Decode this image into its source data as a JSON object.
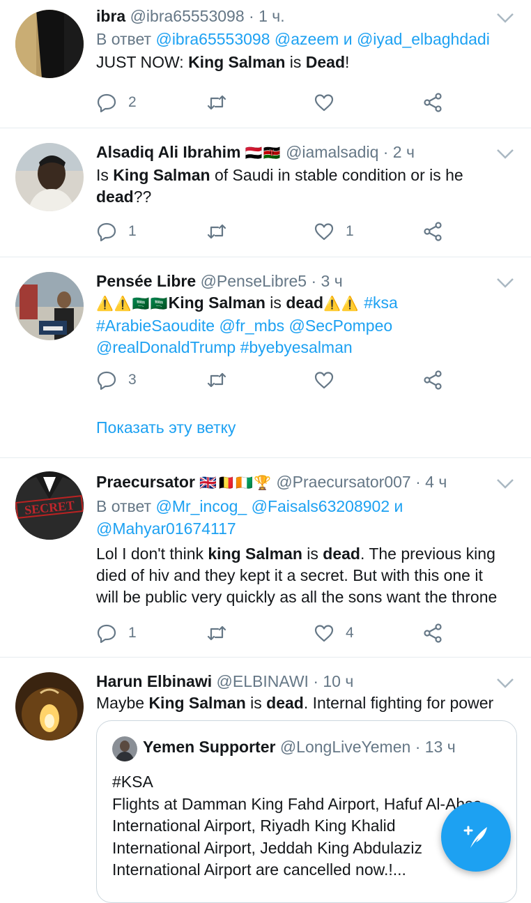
{
  "tweets": [
    {
      "name": "ibra",
      "handle": "@ibra65553098",
      "time": "· 1 ч.",
      "reply_prefix": "В ответ",
      "reply_to": [
        "@ibra65553098",
        "@azeem"
      ],
      "reply_and": "и",
      "reply_last": "@iyad_elbaghdadi",
      "text": [
        "JUST NOW: ",
        "King Salman",
        " is ",
        "Dead",
        "!"
      ],
      "replies": "2",
      "retweets": "",
      "likes": ""
    },
    {
      "name": "Alsadiq Ali Ibrahim",
      "flags": "🇾🇪🇰🇪",
      "handle": "@iamalsadiq",
      "time": "· 2 ч",
      "text": [
        "Is ",
        "King Salman",
        " of Saudi in stable condition or is he ",
        "dead",
        "??"
      ],
      "replies": "1",
      "retweets": "",
      "likes": "1"
    },
    {
      "name": "Pensée Libre",
      "handle": "@PenseLibre5",
      "time": "· 3 ч",
      "line1_warn": "⚠️⚠️🇸🇦🇸🇦",
      "line1_bold1": "King Salman",
      "line1_mid": " is ",
      "line1_bold2": "dead",
      "line1_warn2": "⚠️⚠️",
      "tag_ksa": "#ksa",
      "line2": [
        "#ArabieSaoudite",
        "@fr_mbs",
        "@SecPompeo"
      ],
      "line3": [
        "@realDonaldTrump",
        "#byebyesalman"
      ],
      "replies": "3",
      "retweets": "",
      "likes": "",
      "show_thread": "Показать эту ветку"
    },
    {
      "name": "Praecursator",
      "flags": "🇬🇧🇧🇪🇨🇮🏆",
      "handle": "@Praecursator007",
      "time": "· 4 ч",
      "reply_prefix": "В ответ",
      "reply_to": [
        "@Mr_incog_",
        "@Faisals63208902"
      ],
      "reply_and": "и",
      "reply_last": "@Mahyar01674117",
      "avatar_text": "SECRET",
      "line1": [
        "Lol I don't think ",
        "king Salman",
        " is ",
        "dead",
        ". The previous king"
      ],
      "line2": "died of hiv and they kept it a secret. But with this one it",
      "line3": "will be public very quickly as all the sons want the throne",
      "replies": "1",
      "retweets": "",
      "likes": "4"
    },
    {
      "name": "Harun Elbinawi",
      "handle": "@ELBINAWI",
      "time": "· 10 ч",
      "text": [
        "Maybe ",
        "King Salman",
        " is ",
        "dead",
        ". Internal fighting for power"
      ],
      "quote": {
        "name": "Yemen Supporter",
        "handle": "@LongLiveYemen",
        "time": "· 13 ч",
        "lines": [
          "#KSA",
          "Flights at Damman King Fahd Airport, Hafuf Al-Ahsa",
          "International Airport, Riyadh King Khalid",
          "International Airport, Jeddah King Abdulaziz",
          "International Airport are cancelled now.!..."
        ]
      }
    }
  ],
  "colors": {
    "accent": "#1da1f2",
    "muted": "#657786",
    "text": "#14171a",
    "divider": "#e6ecf0"
  },
  "icons": [
    "reply-icon",
    "retweet-icon",
    "like-icon",
    "share-icon",
    "chevron-down-icon",
    "compose-icon"
  ]
}
